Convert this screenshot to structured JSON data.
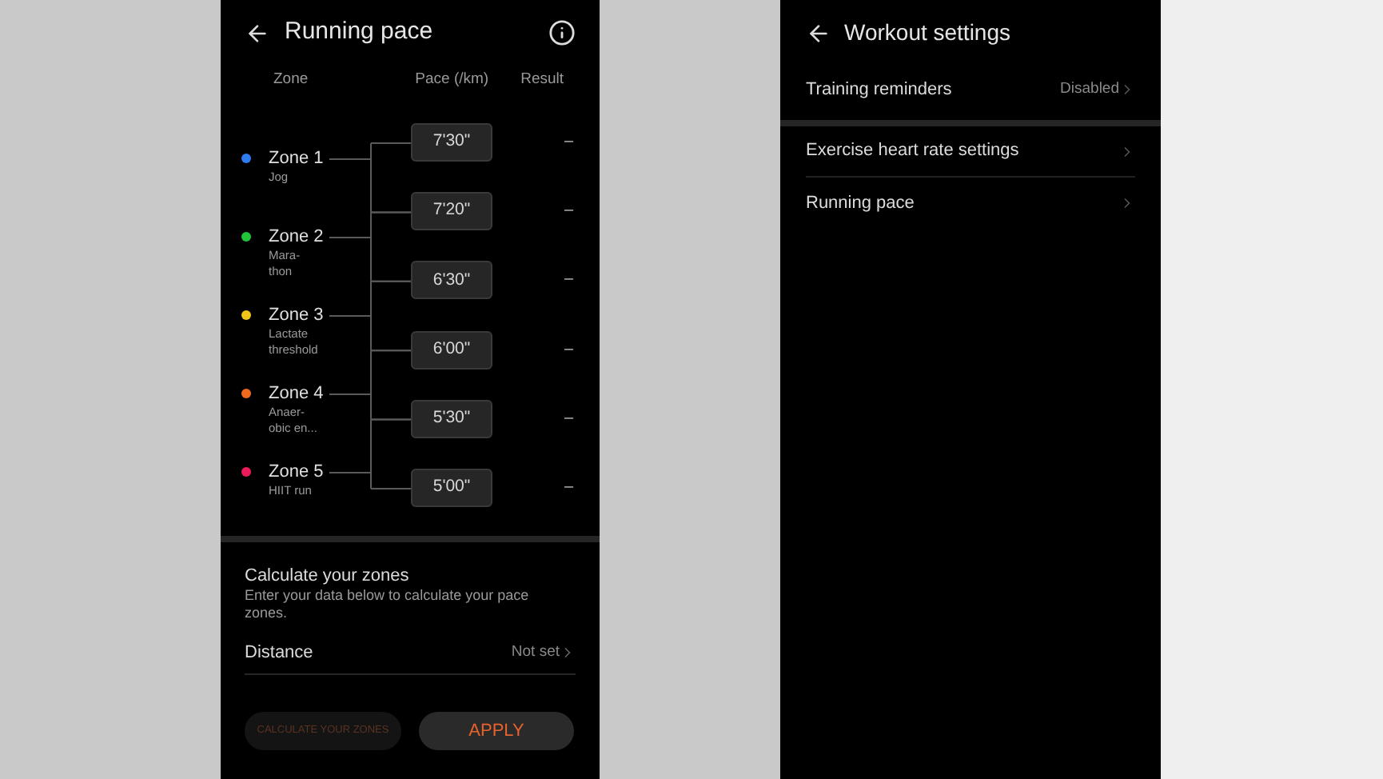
{
  "pace_screen": {
    "title": "Running pace",
    "columns": [
      "Zone",
      "Pace (/km)",
      "Result"
    ],
    "zones": [
      {
        "name": "Zone 1",
        "description": "Jog",
        "color": "#2f7bf0"
      },
      {
        "name": "Zone 2",
        "description": "Mara-\nthon",
        "color": "#22c43a"
      },
      {
        "name": "Zone 3",
        "description": "Lactate\nthreshold",
        "color": "#f0c419"
      },
      {
        "name": "Zone 4",
        "description": "Anaer-\nobic en...",
        "color": "#f06a1e"
      },
      {
        "name": "Zone 5",
        "description": "HIIT run",
        "color": "#ef1a5a"
      }
    ],
    "paces": [
      {
        "pace": "7'30\"",
        "result": "–"
      },
      {
        "pace": "7'20\"",
        "result": "–"
      },
      {
        "pace": "6'30\"",
        "result": "–"
      },
      {
        "pace": "6'00\"",
        "result": "–"
      },
      {
        "pace": "5'30\"",
        "result": "–"
      },
      {
        "pace": "5'00\"",
        "result": "–"
      }
    ],
    "calculate": {
      "title": "Calculate your zones",
      "description": "Enter your data below to calculate your pace zones.",
      "rows": [
        {
          "label": "Distance",
          "value": "Not set"
        }
      ]
    },
    "buttons": [
      {
        "label": "CALCULATE YOUR ZONES",
        "disabled": true
      },
      {
        "label": "APPLY",
        "disabled": false
      }
    ]
  },
  "settings_screen": {
    "title": "Workout settings",
    "groups": [
      [
        {
          "label": "Training reminders",
          "value": "Disabled"
        }
      ],
      [
        {
          "label": "Exercise heart rate settings"
        },
        {
          "label": "Running pace"
        }
      ]
    ]
  }
}
